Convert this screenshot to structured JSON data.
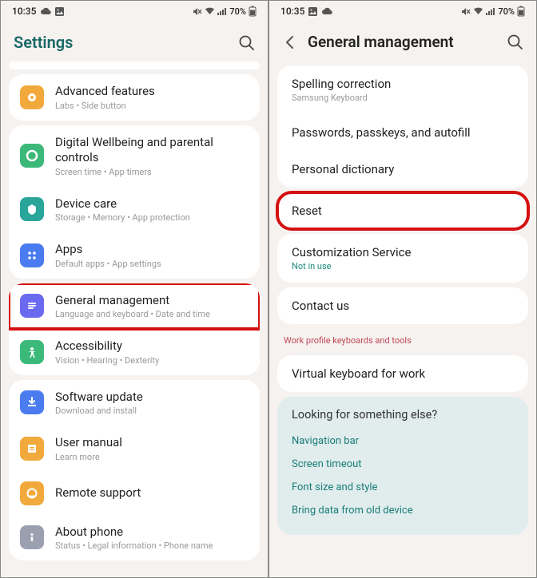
{
  "status": {
    "time": "10:35",
    "battery": "70%"
  },
  "left": {
    "title": "Settings",
    "groups": [
      {
        "items": [
          {
            "icon": "advanced",
            "color": "#f2a93b",
            "title": "Advanced features",
            "subtitle": "Labs  •  Side button"
          }
        ]
      },
      {
        "items": [
          {
            "icon": "wellbeing",
            "color": "#3cb878",
            "title": "Digital Wellbeing and parental controls",
            "subtitle": "Screen time  •  App timers"
          },
          {
            "icon": "devicecare",
            "color": "#2aa59a",
            "title": "Device care",
            "subtitle": "Storage  •  Memory  •  App protection"
          },
          {
            "icon": "apps",
            "color": "#4a7cf0",
            "title": "Apps",
            "subtitle": "Default apps  •  App settings"
          }
        ]
      },
      {
        "items": [
          {
            "icon": "general",
            "color": "#6a6af0",
            "title": "General management",
            "subtitle": "Language and keyboard  •  Date and time",
            "highlight": true
          },
          {
            "icon": "accessibility",
            "color": "#3cb878",
            "title": "Accessibility",
            "subtitle": "Vision  •  Hearing  •  Dexterity"
          }
        ]
      },
      {
        "items": [
          {
            "icon": "update",
            "color": "#4a7cf0",
            "title": "Software update",
            "subtitle": "Download and install"
          },
          {
            "icon": "manual",
            "color": "#f2a93b",
            "title": "User manual",
            "subtitle": "Learn more"
          },
          {
            "icon": "remote",
            "color": "#f2a93b",
            "title": "Remote support",
            "subtitle": ""
          },
          {
            "icon": "about",
            "color": "#9aa0b0",
            "title": "About phone",
            "subtitle": "Status  •  Legal information  •  Phone name"
          }
        ]
      }
    ]
  },
  "right": {
    "title": "General management",
    "groups": [
      {
        "type": "card",
        "items": [
          {
            "title": "Spelling correction",
            "subtitle": "Samsung Keyboard",
            "subtitleClass": "gray"
          },
          {
            "title": "Passwords, passkeys, and autofill"
          },
          {
            "title": "Personal dictionary"
          }
        ]
      },
      {
        "type": "card",
        "highlight": true,
        "items": [
          {
            "title": "Reset"
          }
        ]
      },
      {
        "type": "card",
        "items": [
          {
            "title": "Customization Service",
            "subtitle": "Not in use"
          }
        ]
      },
      {
        "type": "card",
        "items": [
          {
            "title": "Contact us"
          }
        ]
      },
      {
        "type": "label",
        "label": "Work profile keyboards and tools"
      },
      {
        "type": "card",
        "items": [
          {
            "title": "Virtual keyboard for work"
          }
        ]
      }
    ],
    "suggest": {
      "title": "Looking for something else?",
      "links": [
        "Navigation bar",
        "Screen timeout",
        "Font size and style",
        "Bring data from old device"
      ]
    }
  }
}
